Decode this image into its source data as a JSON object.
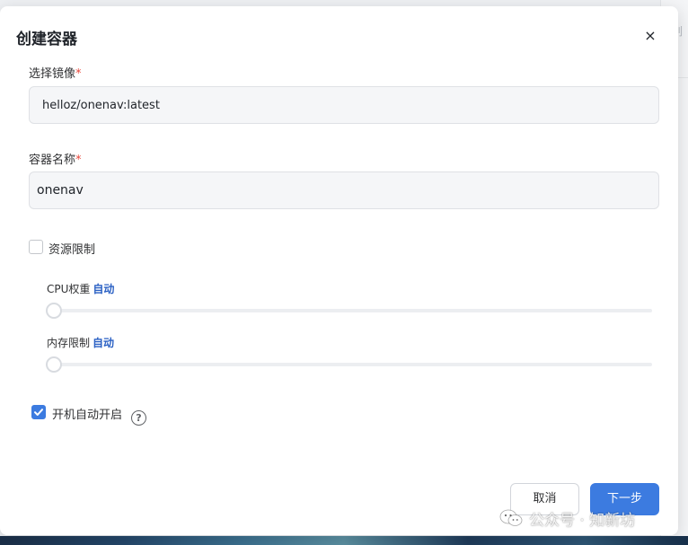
{
  "background": {
    "right_strip_text": "刷"
  },
  "dialog": {
    "title": "创建容器",
    "close_glyph": "×"
  },
  "form": {
    "image": {
      "label": "选择镜像",
      "required_mark": "*",
      "value": "helloz/onenav:latest"
    },
    "container_name": {
      "label": "容器名称",
      "required_mark": "*",
      "value": "onenav"
    },
    "resource_limit": {
      "label": "资源限制",
      "checked": false
    },
    "cpu_weight": {
      "label": "CPU权重",
      "auto_text": "自动",
      "value": 0
    },
    "memory_limit": {
      "label": "内存限制",
      "auto_text": "自动",
      "value": 0
    },
    "autostart": {
      "label": "开机自动开启",
      "checked": true,
      "help_glyph": "?"
    }
  },
  "footer": {
    "cancel_label": "取消",
    "next_label": "下一步"
  },
  "watermark": {
    "text": "公众号 · 知新坊",
    "icon": "wechat-icon"
  },
  "colors": {
    "primary": "#3c7be0",
    "auto_text": "#2b61c4",
    "required": "#e8473c"
  }
}
